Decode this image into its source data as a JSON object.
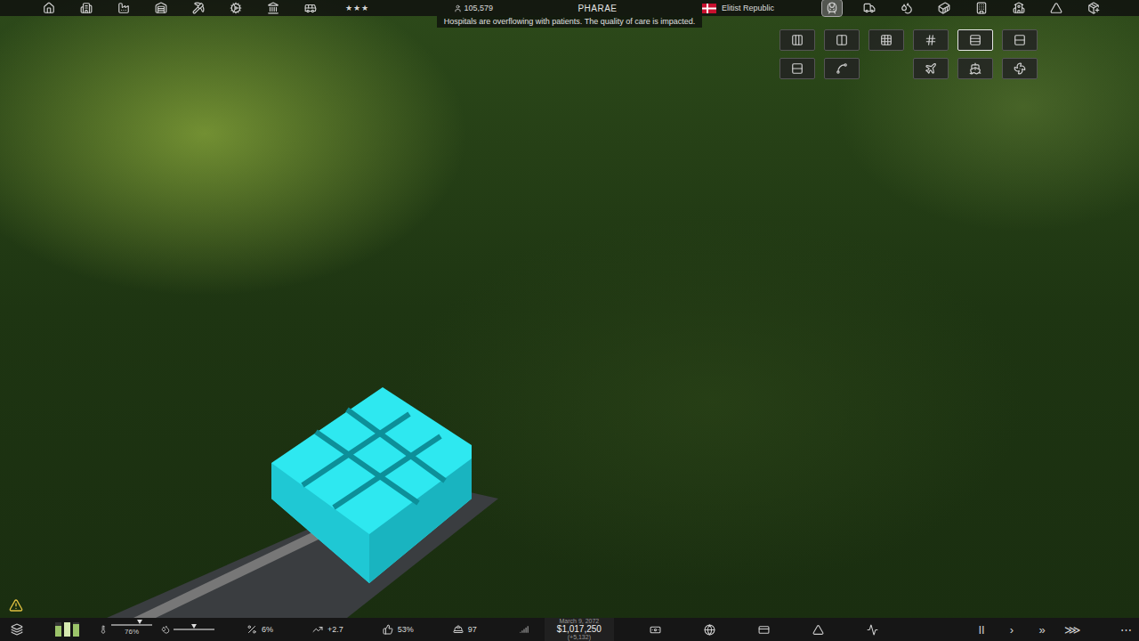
{
  "top_bar": {
    "left_tools": [
      {
        "kind": "residential",
        "selected": false
      },
      {
        "kind": "commercial",
        "selected": false
      },
      {
        "kind": "industry",
        "selected": false
      },
      {
        "kind": "storage",
        "selected": false
      },
      {
        "kind": "mining",
        "selected": false
      },
      {
        "kind": "utilities",
        "selected": false
      },
      {
        "kind": "government",
        "selected": false
      },
      {
        "kind": "transport",
        "selected": false
      }
    ],
    "rating": "★★★",
    "population": "105,579",
    "city": "PHARAE",
    "government": "Elitist Republic",
    "notification": "Hospitals are overflowing with patients. The quality of care is impacted.",
    "right_tools": [
      {
        "kind": "rail",
        "selected": true
      },
      {
        "kind": "vehicles",
        "selected": false
      },
      {
        "kind": "water",
        "selected": false
      },
      {
        "kind": "cargo",
        "selected": false
      },
      {
        "kind": "offices",
        "selected": false
      },
      {
        "kind": "education",
        "selected": false
      },
      {
        "kind": "terrain",
        "selected": false
      },
      {
        "kind": "add",
        "selected": false
      }
    ]
  },
  "build_menu": {
    "items": [
      {
        "kind": "station",
        "selected": false
      },
      {
        "kind": "platform",
        "selected": false
      },
      {
        "kind": "depot",
        "selected": false
      },
      {
        "kind": "signal",
        "selected": false
      },
      {
        "kind": "bridge",
        "selected": true
      },
      {
        "kind": "tunnel",
        "selected": false
      },
      {
        "kind": "track",
        "selected": false
      },
      {
        "kind": "curve",
        "selected": false
      },
      {
        "kind": "airport",
        "selected": false
      },
      {
        "kind": "port",
        "selected": false
      },
      {
        "kind": "drone",
        "selected": false
      }
    ]
  },
  "status_bar": {
    "meters": [
      {
        "level": 0.75,
        "color": "#9cc46a"
      },
      {
        "level": 1,
        "color": "#d6e9b0"
      },
      {
        "level": 0.85,
        "color": "#9cc46a"
      }
    ],
    "temperature": {
      "level": 0.7,
      "reading": "76%"
    },
    "water": {
      "level": 0.5
    },
    "stats": [
      {
        "kind": "unemployment",
        "value": "6%"
      },
      {
        "kind": "growth",
        "value": "+2.7"
      },
      {
        "kind": "approval",
        "value": "53%"
      },
      {
        "kind": "workers",
        "value": "97"
      }
    ],
    "date": "March 9, 2072",
    "money": "$1,017,250",
    "balance_change": "(+5,132)",
    "speed": [
      {
        "label": "II",
        "selected": false
      },
      {
        "label": "›",
        "selected": false
      },
      {
        "label": "»",
        "selected": false
      },
      {
        "label": "⋙",
        "selected": false
      }
    ],
    "more": "⋯"
  }
}
